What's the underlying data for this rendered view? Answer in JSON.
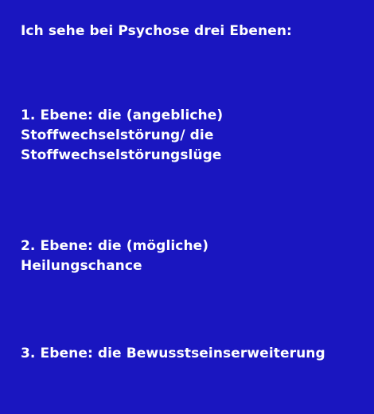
{
  "post": {
    "intro": "Ich sehe bei Psychose drei Ebenen:",
    "levels": [
      {
        "text": "1. Ebene: die (angebliche)\nStoffwechselstörung/ die\nStoffwechselstörungslüge"
      },
      {
        "text": "2. Ebene: die (mögliche)\nHeilungschance"
      },
      {
        "text": "3. Ebene: die Bewusstseinserweiterung"
      }
    ],
    "colors": {
      "background": "#1a16c0",
      "text": "#ffffff"
    }
  }
}
